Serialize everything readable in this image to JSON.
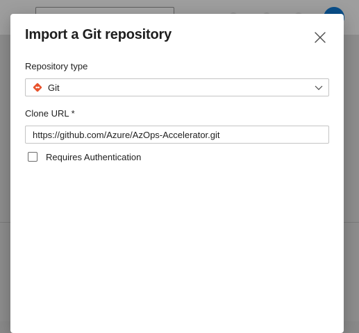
{
  "dialog": {
    "title": "Import a Git repository"
  },
  "repository_type": {
    "label": "Repository type",
    "selected": "Git",
    "icon": "git-icon",
    "icon_color": "#e8532d"
  },
  "clone_url": {
    "label": "Clone URL",
    "required_marker": "*",
    "value": "https://github.com/Azure/AzOps-Accelerator.git"
  },
  "requires_auth": {
    "label": "Requires Authentication",
    "checked": false
  }
}
